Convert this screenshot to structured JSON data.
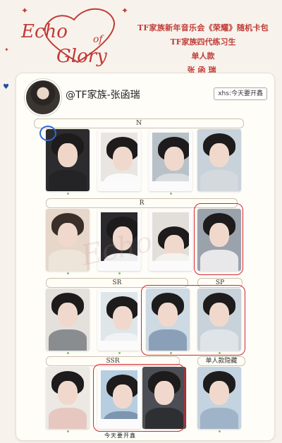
{
  "header": {
    "title": "TF家族新年音乐会《荣耀》随机卡包",
    "subtitle": "TF家族四代练习生",
    "type": "单人款",
    "name": "张函瑞"
  },
  "profile": {
    "handle": "@TF家族-张函瑞",
    "badge": "xhs:今天要开鑫"
  },
  "tiers": {
    "n": "N",
    "r": "R",
    "sr": "SR",
    "sp": "SP",
    "ssr": "SSR",
    "hidden": "单人款隐藏"
  },
  "footer": {
    "text": "今天要开鑫"
  },
  "colors": {
    "accent_red": "#c23a36",
    "mark_red": "#d2282f",
    "mark_blue": "#2f6ad1"
  }
}
